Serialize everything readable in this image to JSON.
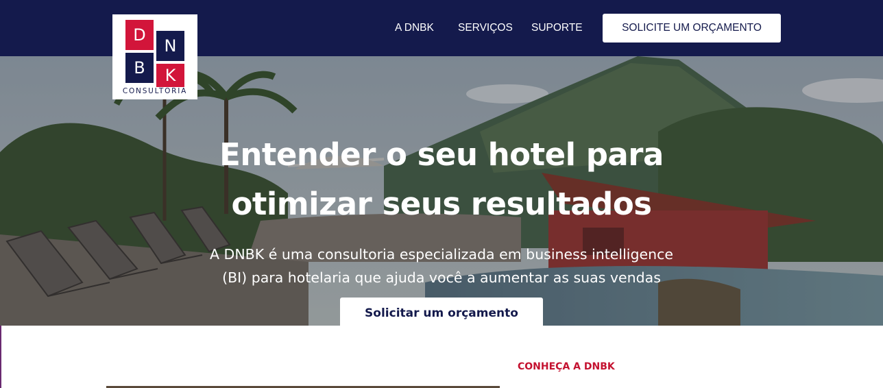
{
  "brand": {
    "logo_letters": [
      "D",
      "N",
      "B",
      "K"
    ],
    "logo_subtitle": "CONSULTORIA"
  },
  "nav": {
    "links": [
      {
        "label": "A DNBK"
      },
      {
        "label": "SERVIÇOS"
      },
      {
        "label": "SUPORTE"
      }
    ],
    "cta_label": "SOLICITE UM ORÇAMENTO"
  },
  "hero": {
    "title_line1": "Entender o seu hotel para",
    "title_line2": "otimizar seus resultados",
    "subtitle_line1": "A DNBK é uma consultoria especializada em business intelligence",
    "subtitle_line2": "(BI) para hotelaria que ajuda você a aumentar as suas vendas",
    "cta_label": "Solicitar um orçamento"
  },
  "about": {
    "section_label": "CONHEÇA A DNBK"
  },
  "colors": {
    "navy": "#141a4c",
    "brand_red": "#d2153a",
    "section_red": "#c41230"
  }
}
